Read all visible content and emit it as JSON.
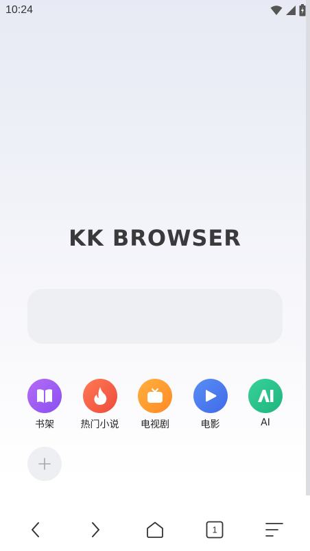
{
  "status_bar": {
    "time": "10:24",
    "icons": [
      "wifi-icon",
      "signal-icon",
      "battery-icon"
    ]
  },
  "brand": {
    "title": "KK BROWSER"
  },
  "search": {
    "placeholder": ""
  },
  "shortcuts": [
    {
      "label": "书架",
      "icon": "bookshelf-icon",
      "color": "#9a5bf0"
    },
    {
      "label": "热门小说",
      "icon": "flame-icon",
      "color": "#f25a42"
    },
    {
      "label": "电视剧",
      "icon": "tv-icon",
      "color": "#ff9a2e"
    },
    {
      "label": "电影",
      "icon": "play-icon",
      "color": "#4a7bf2"
    },
    {
      "label": "AI",
      "icon": "ai-icon",
      "color": "#27c28a"
    }
  ],
  "add_shortcut": {
    "icon": "plus-icon"
  },
  "bottom_nav": {
    "back": "chevron-left-icon",
    "forward": "chevron-right-icon",
    "home": "home-icon",
    "tabs": {
      "icon": "tabs-icon",
      "count": "1"
    },
    "menu": "menu-icon"
  }
}
